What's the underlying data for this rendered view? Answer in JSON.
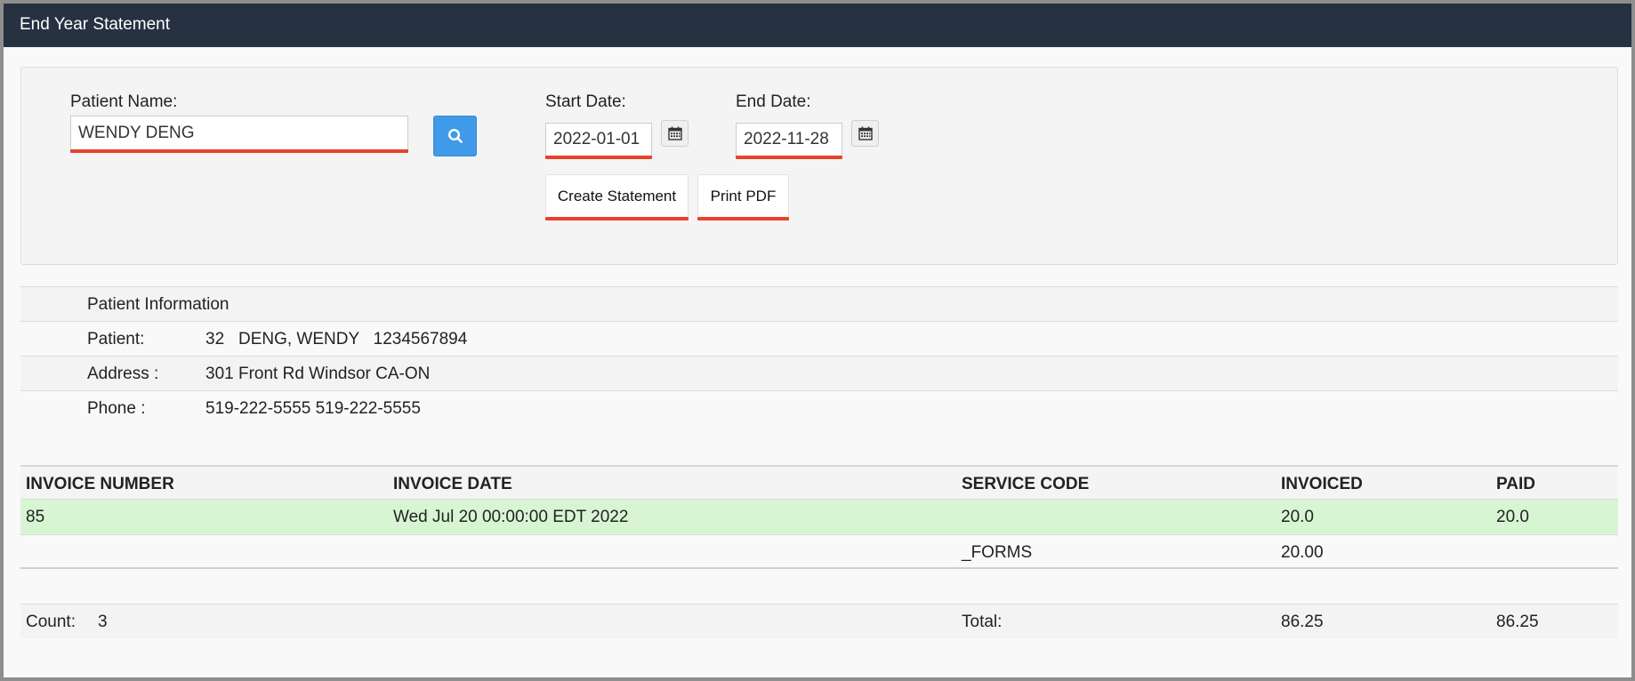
{
  "window": {
    "title": "End Year Statement"
  },
  "search": {
    "patient_label": "Patient Name:",
    "patient_value": "WENDY DENG",
    "start_label": "Start Date:",
    "start_value": "2022-01-01",
    "end_label": "End Date:",
    "end_value": "2022-11-28",
    "create_label": "Create Statement",
    "print_label": "Print PDF",
    "search_icon": "search-icon",
    "calendar_icon": "calendar-icon"
  },
  "patient_info": {
    "heading": "Patient Information",
    "rows": [
      {
        "key": "Patient:",
        "value": "32   DENG, WENDY   1234567894"
      },
      {
        "key": "Address :",
        "value": "301 Front Rd Windsor CA-ON"
      },
      {
        "key": "Phone :",
        "value": "519-222-5555 519-222-5555"
      }
    ]
  },
  "invoices": {
    "headers": [
      "INVOICE NUMBER",
      "INVOICE DATE",
      "SERVICE CODE",
      "INVOICED",
      "PAID"
    ],
    "rows": [
      {
        "number": "85",
        "date": "Wed Jul 20 00:00:00 EDT 2022",
        "service": "",
        "invoiced": "20.0",
        "paid": "20.0"
      },
      {
        "number": "",
        "date": "",
        "service": "_FORMS",
        "invoiced": "20.00",
        "paid": ""
      }
    ],
    "footer": {
      "count_label": "Count:",
      "count_value": "3",
      "total_label": "Total:",
      "total_invoiced": "86.25",
      "total_paid": "86.25"
    }
  },
  "colors": {
    "titlebar": "#263142",
    "search_button": "#419ae8",
    "highlight_row": "#d8f5d3",
    "underline": "#e5432d"
  }
}
